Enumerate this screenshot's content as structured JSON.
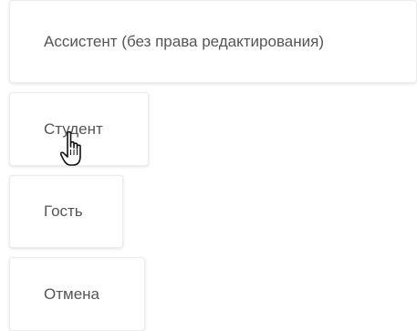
{
  "menu": {
    "options": [
      {
        "label": "Ассистент (без права редактирования)"
      },
      {
        "label": "Студент"
      },
      {
        "label": "Гость"
      },
      {
        "label": "Отмена"
      }
    ]
  },
  "cursor": {
    "icon": "hand-pointer-icon"
  }
}
